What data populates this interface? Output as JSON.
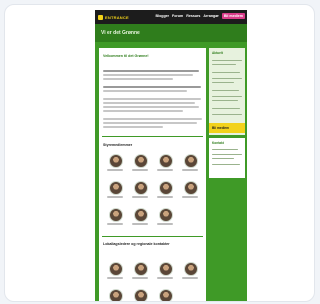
{
  "header": {
    "logo_text": "ENTRANCE",
    "nav": [
      "Blogger",
      "Forum",
      "Ressurs",
      "Arrangør"
    ],
    "cta": "Bli medlem"
  },
  "banner": {
    "title": "Vi er det Grønne"
  },
  "main": {
    "intro_title": "Velkommen til det Grønne!",
    "section1_title": "Styremedlemmer",
    "section2_title": "Lokallagsledere og regionale kontakter"
  },
  "sidebar": {
    "title1": "Aktuelt",
    "yellow_label": "Bli medlem",
    "title2": "Kontakt"
  },
  "colors": {
    "brand_green": "#3f9a27",
    "dark_green": "#2f7d1c",
    "top": "#1c1c1c",
    "accent_pink": "#d93c8a",
    "accent_yellow": "#f2d21a"
  }
}
